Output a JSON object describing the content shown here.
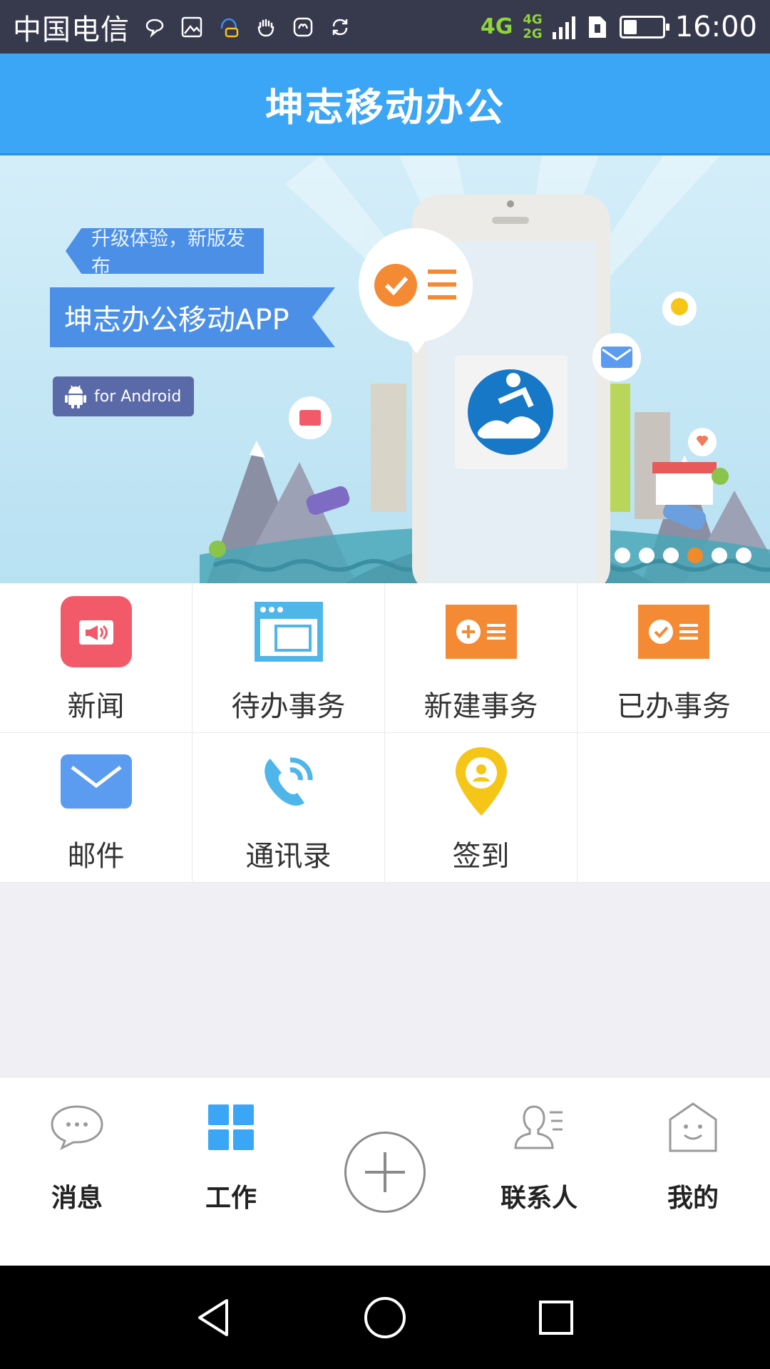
{
  "status_bar": {
    "carrier": "中国电信",
    "network": "4G",
    "network_sub_top": "4G",
    "network_sub_bottom": "2G",
    "battery_level": 0.35,
    "time": "16:00"
  },
  "header": {
    "title": "坤志移动办公"
  },
  "banner": {
    "ribbon_small": "升级体验，新版发布",
    "ribbon_big": "坤志办公移动APP",
    "badge": "for Android",
    "slide_count": 6,
    "active_slide": 4
  },
  "grid": {
    "items": [
      {
        "label": "新闻",
        "icon": "megaphone-icon",
        "color": "#f25a6a"
      },
      {
        "label": "待办事务",
        "icon": "window-icon",
        "color": "#4fb6ea"
      },
      {
        "label": "新建事务",
        "icon": "badge-plus-icon",
        "color": "#f58a35"
      },
      {
        "label": "已办事务",
        "icon": "badge-check-icon",
        "color": "#f58a35"
      },
      {
        "label": "邮件",
        "icon": "mail-icon",
        "color": "#5b9cf0"
      },
      {
        "label": "通讯录",
        "icon": "phone-icon",
        "color": "#4fb6ea"
      },
      {
        "label": "签到",
        "icon": "location-pin-icon",
        "color": "#f5c518"
      }
    ]
  },
  "bottom_nav": {
    "items": [
      {
        "label": "消息",
        "icon": "chat-bubble-icon"
      },
      {
        "label": "工作",
        "icon": "grid-icon",
        "active": true
      },
      {
        "label": "联系人",
        "icon": "contact-icon"
      },
      {
        "label": "我的",
        "icon": "home-face-icon"
      }
    ],
    "center_button_icon": "plus-icon",
    "active_color": "#3aa6f5"
  }
}
